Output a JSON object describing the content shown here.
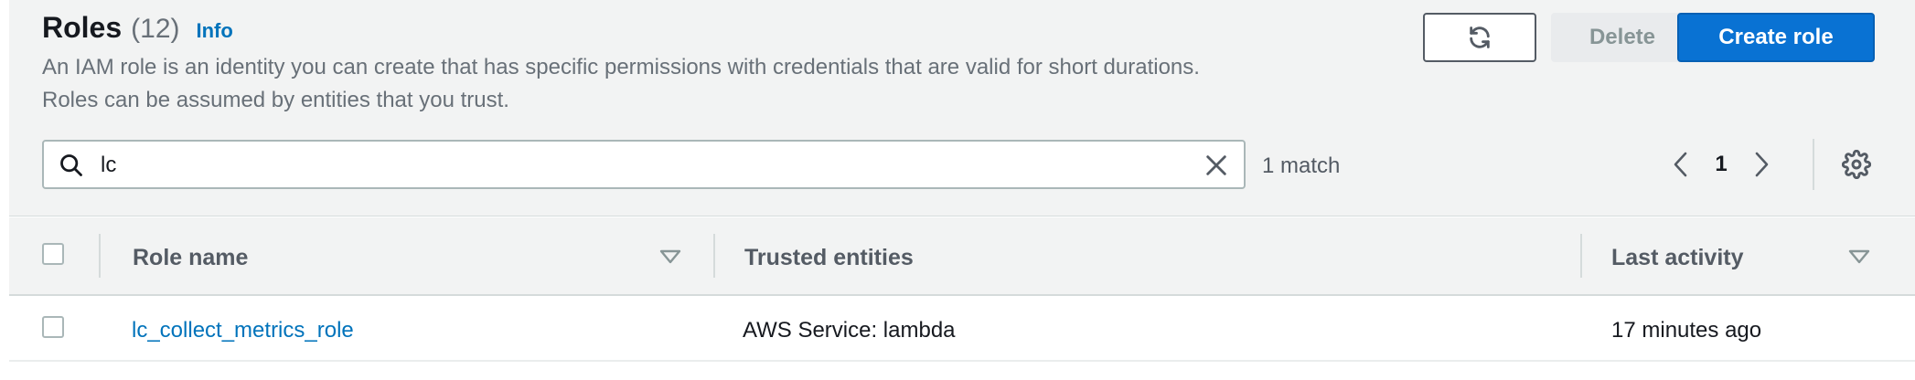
{
  "header": {
    "title": "Roles",
    "count": "(12)",
    "info_label": "Info",
    "description": "An IAM role is an identity you can create that has specific permissions with credentials that are valid for short durations. Roles can be assumed by entities that you trust."
  },
  "actions": {
    "refresh_icon": "refresh-icon",
    "delete_label": "Delete",
    "create_label": "Create role"
  },
  "search": {
    "value": "lc",
    "match_text": "1 match"
  },
  "pagination": {
    "current_page": "1"
  },
  "table": {
    "columns": [
      {
        "label": "Role name",
        "sortable": true
      },
      {
        "label": "Trusted entities",
        "sortable": false
      },
      {
        "label": "Last activity",
        "sortable": true
      }
    ],
    "rows": [
      {
        "role_name": "lc_collect_metrics_role",
        "trusted_entities": "AWS Service: lambda",
        "last_activity": "17 minutes ago"
      }
    ]
  },
  "colors": {
    "accent": "#0073bb",
    "primary_button": "#0972d3",
    "header_bg": "#f2f3f3"
  }
}
